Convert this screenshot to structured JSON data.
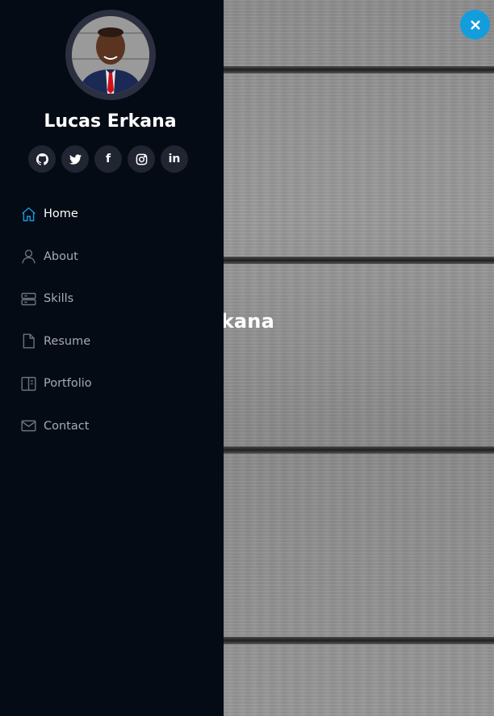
{
  "profile": {
    "name": "Lucas Erkana"
  },
  "social": [
    {
      "label": "GitHub",
      "icon": "github-icon"
    },
    {
      "label": "Twitter",
      "icon": "twitter-icon",
      "glyph": ""
    },
    {
      "label": "Facebook",
      "icon": "facebook-icon",
      "glyph": "f"
    },
    {
      "label": "Instagram",
      "icon": "instagram-icon"
    },
    {
      "label": "LinkedIn",
      "icon": "linkedin-icon",
      "glyph": "in"
    }
  ],
  "nav": [
    {
      "label": "Home",
      "icon": "home-icon",
      "active": true
    },
    {
      "label": "About",
      "icon": "person-icon",
      "active": false
    },
    {
      "label": "Skills",
      "icon": "server-icon",
      "active": false
    },
    {
      "label": "Resume",
      "icon": "file-icon",
      "active": false
    },
    {
      "label": "Portfolio",
      "icon": "book-icon",
      "active": false
    },
    {
      "label": "Contact",
      "icon": "envelope-icon",
      "active": false
    }
  ],
  "hero": {
    "title_visible": "kana"
  },
  "colors": {
    "accent": "#149ddd",
    "sidebar_bg": "#040b14",
    "social_bg": "#212431"
  }
}
